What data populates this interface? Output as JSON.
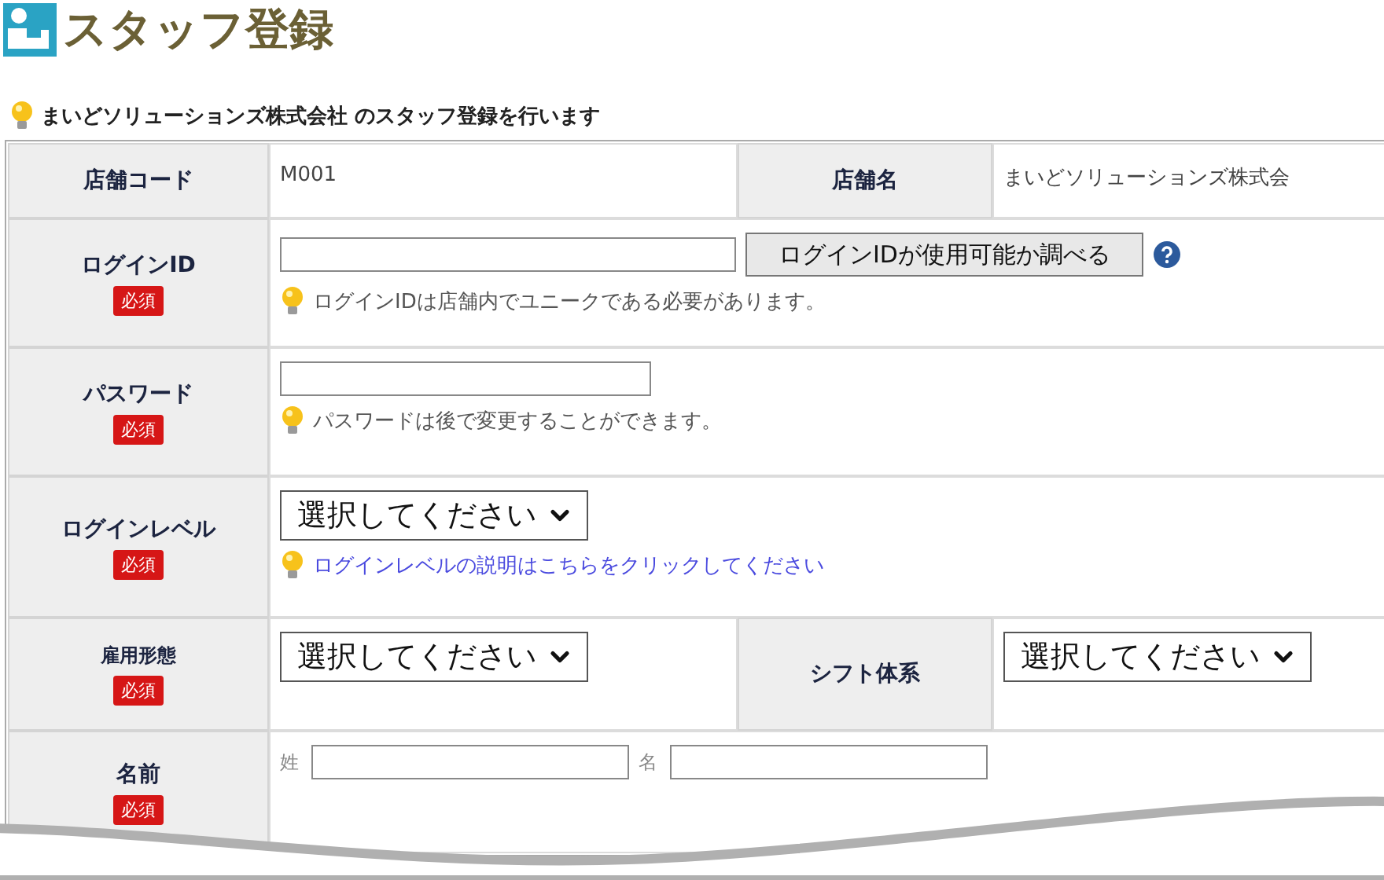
{
  "page_title": "スタッフ登録",
  "notice": "まいどソリューションズ株式会社 のスタッフ登録を行います",
  "rows": [
    {
      "label": "店舗コード",
      "fields": [
        {
          "kind": "text",
          "value": "M001"
        }
      ],
      "second": {
        "label": "店舗名",
        "fields": [
          {
            "kind": "text",
            "value": "まいどソリューションズ株式会"
          }
        ]
      }
    },
    {
      "label": "ログインID",
      "required_label": "必須",
      "fields": [
        {
          "kind": "input"
        },
        {
          "kind": "button",
          "label": "ログインIDが使用可能か調べる"
        },
        {
          "kind": "help"
        },
        {
          "kind": "hint",
          "text": "ログインIDは店舗内でユニークである必要があります。"
        }
      ]
    },
    {
      "label": "パスワード",
      "required_label": "必須",
      "fields": [
        {
          "kind": "input"
        },
        {
          "kind": "hint",
          "text": "パスワードは後で変更することができます。"
        }
      ]
    },
    {
      "label": "ログインレベル",
      "required_label": "必須",
      "fields": [
        {
          "kind": "select",
          "value": "選択してください"
        },
        {
          "kind": "link",
          "text": "ログインレベルの説明はこちらをクリックしてください"
        }
      ]
    },
    {
      "label": "雇用形態",
      "required_label": "必須",
      "fields": [
        {
          "kind": "select",
          "value": "選択してください"
        }
      ],
      "second": {
        "label": "シフト体系",
        "fields": [
          {
            "kind": "select",
            "value": "選択してください"
          }
        ]
      }
    },
    {
      "label": "名前",
      "required_label": "必須",
      "fields": [
        {
          "kind": "input",
          "prefix": "姓"
        },
        {
          "kind": "input",
          "prefix": "名"
        }
      ]
    }
  ]
}
